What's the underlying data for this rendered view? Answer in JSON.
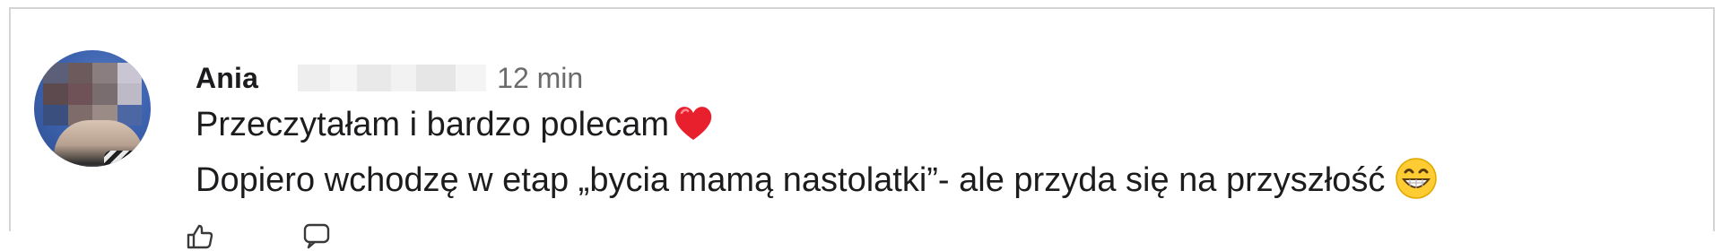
{
  "comment": {
    "author": "Ania",
    "time": "12 min",
    "lines": [
      "Przeczytałam i bardzo polecam",
      "Dopiero wchodzę w etap „bycia mamą nastolatki”- ale przyda się na przyszłość"
    ],
    "line1_emoji": "heart-icon",
    "line2_emoji": "grinning-face-icon",
    "avatar": "profile-photo-pixelated"
  },
  "actions": [
    "like-icon",
    "reply-icon"
  ],
  "colors": {
    "text": "#1c1c1e",
    "meta": "#6b6b6b",
    "border": "#d4d4d4",
    "heart": "#e8202e",
    "emoji_yellow": "#ffcc33"
  }
}
